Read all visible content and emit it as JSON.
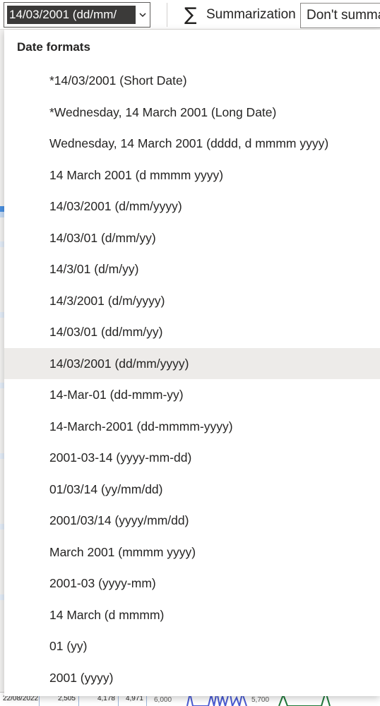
{
  "toolbar": {
    "format_value": "14/03/2001 (dd/mm/",
    "summarization_label": "Summarization",
    "summarization_value": "Don't summa"
  },
  "dropdown": {
    "header": "Date formats",
    "selected_index": 9,
    "options": [
      "*14/03/2001 (Short Date)",
      "*Wednesday, 14 March 2001 (Long Date)",
      "Wednesday, 14 March 2001 (dddd, d mmmm yyyy)",
      "14 March 2001 (d mmmm yyyy)",
      "14/03/2001 (d/mm/yyyy)",
      "14/03/01 (d/mm/yy)",
      "14/3/01 (d/m/yy)",
      "14/3/2001 (d/m/yyyy)",
      "14/03/01 (dd/mm/yy)",
      "14/03/2001 (dd/mm/yyyy)",
      "14-Mar-01 (dd-mmm-yy)",
      "14-March-2001 (dd-mmmm-yyyy)",
      "2001-03-14 (yyyy-mm-dd)",
      "01/03/14 (yy/mm/dd)",
      "2001/03/14 (yyyy/mm/dd)",
      "March 2001 (mmmm yyyy)",
      "2001-03 (yyyy-mm)",
      "14 March (d mmmm)",
      "01 (yy)",
      "2001 (yyyy)"
    ]
  },
  "background": {
    "table_row": [
      "22/08/2022",
      "2,505",
      "4,178",
      "4,971"
    ],
    "axis_labels": [
      "6,000",
      "5,700"
    ]
  },
  "colors": {
    "selected_bg": "#edebe9",
    "select_highlight": "#3b3a39",
    "chart_blue": "#4a5bd4",
    "chart_green": "#1f7a3a"
  }
}
